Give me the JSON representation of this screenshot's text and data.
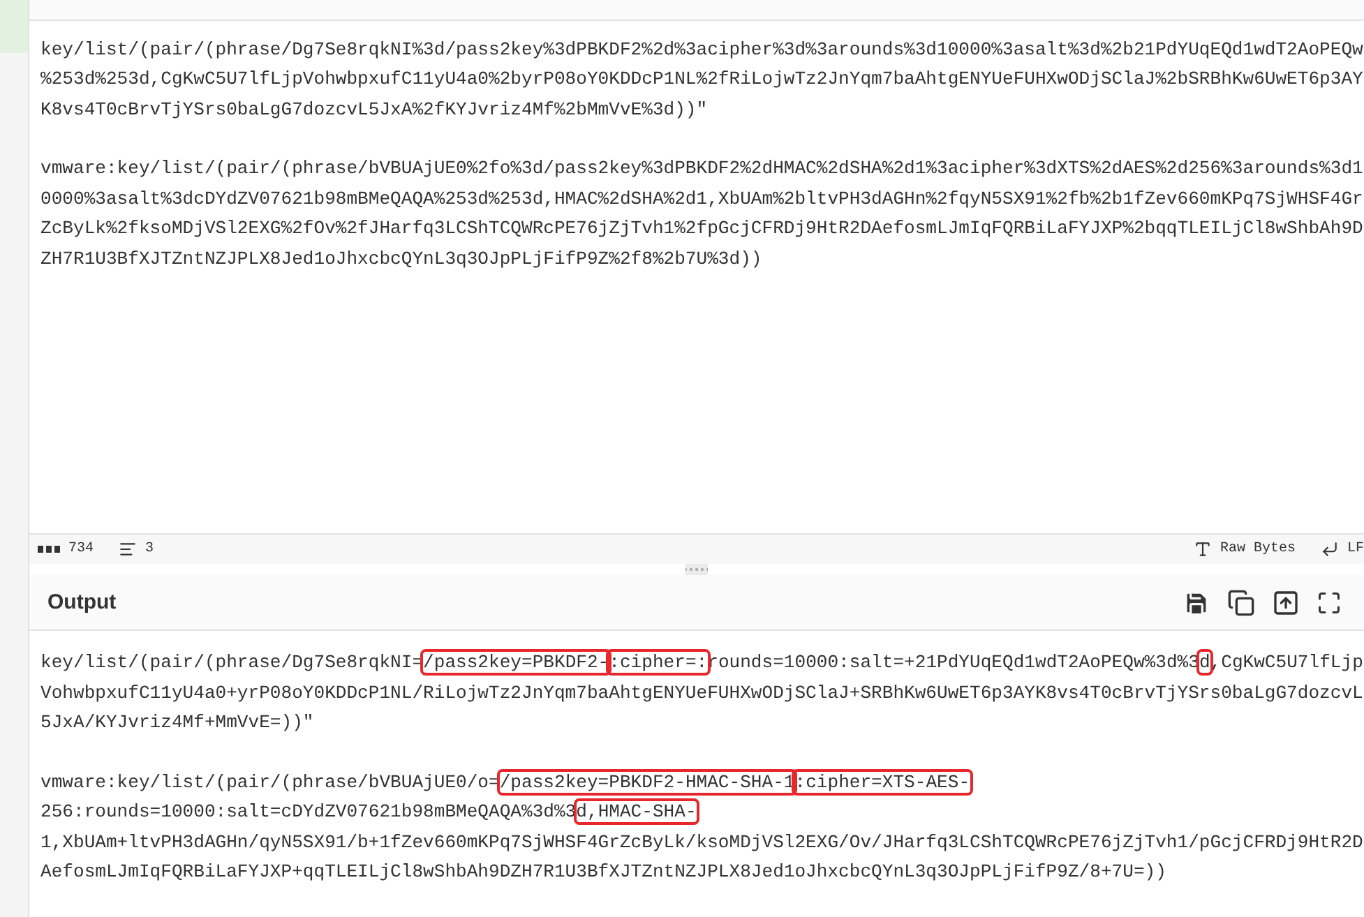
{
  "input": {
    "paragraphs": [
      "key/list/(pair/(phrase/Dg7Se8rqkNI%3d/pass2key%3dPBKDF2%2d%3acipher%3d%3arounds%3d10000%3asalt%3d%2b21PdYUqEQd1wdT2AoPEQw%253d%253d,CgKwC5U7lfLjpVohwbpxufC11yU4a0%2byrP08oY0KDDcP1NL%2fRiLojwTz2JnYqm7baAhtgENYUeFUHXwODjSClaJ%2bSRBhKw6UwET6p3AYK8vs4T0cBrvTjYSrs0baLgG7dozcvL5JxA%2fKYJvriz4Mf%2bMmVvE%3d))\"",
      "vmware:key/list/(pair/(phrase/bVBUAjUE0%2fo%3d/pass2key%3dPBKDF2%2dHMAC%2dSHA%2d1%3acipher%3dXTS%2dAES%2d256%3arounds%3d10000%3asalt%3dcDYdZV07621b98mBMeQAQA%253d%253d,HMAC%2dSHA%2d1,XbUAm%2bltvPH3dAGHn%2fqyN5SX91%2fb%2b1fZev660mKPq7SjWHSF4GrZcByLk%2fksoMDjVSl2EXG%2fOv%2fJHarfq3LCShTCQWRcPE76jZjTvh1%2fpGcjCFRDj9HtR2DAefosmLJmIqFQRBiLaFYJXP%2bqqTLEILjCl8wShbAh9DZH7R1U3BfXJTZntNZJPLX8Jed1oJhxcbcQYnL3q3OJpPLjFifP9Z%2f8%2b7U%3d))"
    ]
  },
  "status_bar": {
    "length": "734",
    "lines": "3",
    "encoding": "Raw Bytes",
    "eol": "LF"
  },
  "output": {
    "title": "Output",
    "paragraphs": [
      [
        {
          "text": "key/list/(pair/(phrase/Dg7Se8rqkNI=",
          "highlighted": false
        },
        {
          "text": "/pass2key=PBKDF2-",
          "highlighted": true
        },
        {
          "text": ":cipher=:",
          "highlighted": true
        },
        {
          "text": "rounds=10000:salt=+21PdYUqEQd1wdT2AoPEQw%3d%3",
          "highlighted": false
        },
        {
          "text": "d",
          "highlighted": true
        },
        {
          "text": ",CgKwC5U7lfLjpVohwbpxufC11yU4a0+yrP08oY0KDDcP1NL/RiLojwTz2JnYqm7baAhtgENYUeFUHXwODjSClaJ+SRBhKw6UwET6p3AYK8vs4T0cBrvTjYSrs0baLgG7dozcvL5JxA/KYJvriz4Mf+MmVvE=))\"",
          "highlighted": false
        }
      ],
      [
        {
          "text": "vmware:key/list/(pair/(phrase/bVBUAjUE0/o=",
          "highlighted": false
        },
        {
          "text": "/pass2key=PBKDF2-HMAC-SHA-1",
          "highlighted": true
        },
        {
          "text": ":cipher=XTS-AES-",
          "highlighted": true
        },
        {
          "text": "256:rounds=10000:salt=cDYdZV07621b98mBMeQAQA%3d%3",
          "highlighted": false
        },
        {
          "text": "d,HMAC-SHA-",
          "highlighted": true
        },
        {
          "text": "1,XbUAm+ltvPH3dAGHn/qyN5SX91/b+1fZev660mKPq7SjWHSF4GrZcByLk/ksoMDjVSl2EXG/Ov/JHarfq3LCShTCQWRcPE76jZjTvh1/pGcjCFRDj9HtR2DAefosmLJmIqFQRBiLaFYJXP+qqTLEILjCl8wShbAh9DZH7R1U3BfXJTZntNZJPLX8Jed1oJhxcbcQYnL3q3OJpPLjFifP9Z/8+7U=))",
          "highlighted": false
        }
      ]
    ]
  }
}
